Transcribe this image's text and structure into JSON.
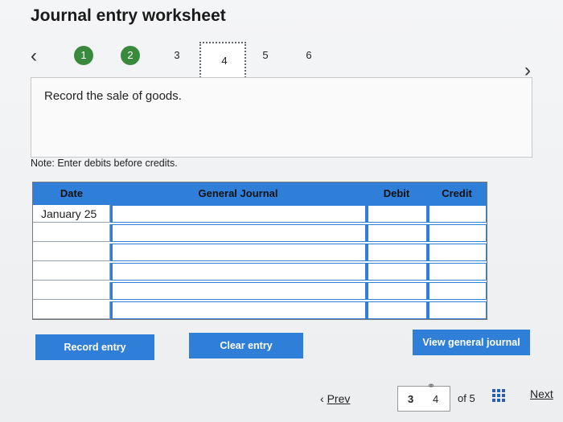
{
  "title": "Journal entry worksheet",
  "nav": {
    "prev_icon": "chevron-left-icon",
    "next_icon": "chevron-right-icon",
    "steps": [
      "1",
      "2",
      "3",
      "4",
      "5",
      "6"
    ],
    "current_step": "4"
  },
  "instruction": "Record the sale of goods.",
  "note": "Note: Enter debits before credits.",
  "journal": {
    "headers": {
      "date": "Date",
      "general_journal": "General Journal",
      "debit": "Debit",
      "credit": "Credit"
    },
    "rows": [
      {
        "date": "January 25"
      },
      {
        "date": ""
      },
      {
        "date": ""
      },
      {
        "date": ""
      },
      {
        "date": ""
      },
      {
        "date": ""
      }
    ]
  },
  "buttons": {
    "record": "Record entry",
    "clear": "Clear entry",
    "view": "View general journal"
  },
  "footer": {
    "prev": "Prev",
    "page_a": "3",
    "page_b": "4",
    "of": "of 5",
    "next": "Next"
  },
  "colors": {
    "accent": "#2f7ed8",
    "done": "#3a8a3e"
  }
}
